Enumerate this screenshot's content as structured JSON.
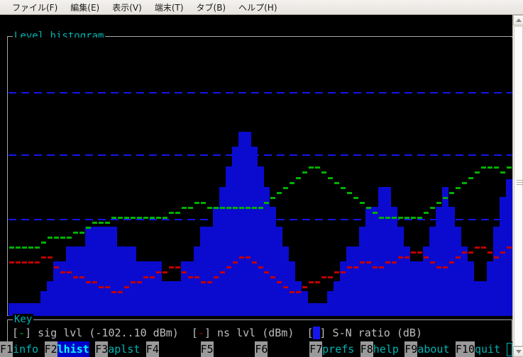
{
  "window": {
    "menu": [
      {
        "label": "ファイル(F)",
        "accel": "F"
      },
      {
        "label": "編集(E)",
        "accel": "E"
      },
      {
        "label": "表示(V)",
        "accel": "V"
      },
      {
        "label": "端末(T)",
        "accel": "T"
      },
      {
        "label": "タブ(B)",
        "accel": "B"
      },
      {
        "label": "ヘルプ(H)",
        "accel": "H"
      }
    ]
  },
  "histogram": {
    "title": "Level histogram"
  },
  "key": {
    "title": "Key",
    "sig_open": "[",
    "sig_mark": "-",
    "sig_close": "]",
    "sig_label": " sig lvl (-102..10 dBm)  ",
    "ns_open": "[",
    "ns_mark": "-",
    "ns_close": "]",
    "ns_label": " ns lvl (dBm)  ",
    "snr_open": "[",
    "snr_mark": " ",
    "snr_close": "]",
    "snr_label": " S-N ratio (dB)"
  },
  "fkeys": [
    {
      "num": "F1",
      "label": "info",
      "selected": false
    },
    {
      "num": "F2",
      "label": "lhist",
      "selected": true
    },
    {
      "num": "F3",
      "label": "aplst",
      "selected": false
    },
    {
      "num": "F4",
      "label": "",
      "selected": false
    },
    {
      "num": "F5",
      "label": "",
      "selected": false
    },
    {
      "num": "F6",
      "label": "",
      "selected": false
    },
    {
      "num": "F7",
      "label": "prefs",
      "selected": false
    },
    {
      "num": "F8",
      "label": "help",
      "selected": false
    },
    {
      "num": "F9",
      "label": "about",
      "selected": false
    },
    {
      "num": "F10",
      "label": "quit",
      "selected": false
    }
  ],
  "colors": {
    "sig": "#00b000",
    "ns": "#c00000",
    "snr": "#0b0bd0",
    "grid": "#1515ee",
    "frame": "#a8a8a8",
    "title": "#00b3b3",
    "background": "#000000"
  },
  "chart_data": {
    "type": "bar",
    "title": "Level histogram",
    "xlabel": "",
    "ylabel": "",
    "ylim": [
      -102,
      10
    ],
    "grid": true,
    "gridlines_y": [
      -12,
      -37,
      -63
    ],
    "legend": [
      "sig lvl (-102..10 dBm)",
      "ns lvl (dBm)",
      "S-N ratio (dB)"
    ],
    "legend_position": "below-plot",
    "n_columns": 79,
    "series": [
      {
        "name": "S-N ratio (dB)",
        "kind": "bar",
        "color": "#0b0bd0",
        "values": [
          5,
          5,
          5,
          5,
          5,
          10,
          14,
          22,
          22,
          28,
          28,
          28,
          36,
          36,
          36,
          36,
          36,
          28,
          28,
          28,
          22,
          22,
          22,
          22,
          14,
          14,
          14,
          22,
          22,
          28,
          36,
          36,
          44,
          52,
          60,
          68,
          74,
          74,
          68,
          60,
          52,
          44,
          36,
          28,
          22,
          14,
          10,
          5,
          5,
          5,
          10,
          14,
          22,
          28,
          28,
          36,
          44,
          44,
          52,
          52,
          44,
          36,
          28,
          22,
          22,
          28,
          36,
          44,
          52,
          44,
          36,
          28,
          22,
          14,
          14,
          22,
          36,
          48,
          55
        ]
      },
      {
        "name": "sig lvl (dBm)",
        "kind": "marker",
        "color": "#00b000",
        "values": [
          -74,
          -74,
          -74,
          -74,
          -74,
          -72,
          -70,
          -70,
          -70,
          -70,
          -68,
          -68,
          -66,
          -64,
          -64,
          -64,
          -62,
          -62,
          -62,
          -62,
          -62,
          -62,
          -62,
          -62,
          -62,
          -60,
          -60,
          -58,
          -58,
          -56,
          -56,
          -58,
          -58,
          -58,
          -58,
          -58,
          -58,
          -58,
          -58,
          -58,
          -56,
          -54,
          -52,
          -50,
          -48,
          -46,
          -44,
          -42,
          -42,
          -44,
          -46,
          -48,
          -50,
          -52,
          -54,
          -56,
          -58,
          -60,
          -62,
          -62,
          -62,
          -62,
          -62,
          -62,
          -62,
          -60,
          -58,
          -56,
          -54,
          -52,
          -50,
          -48,
          -46,
          -44,
          -42,
          -42,
          -42,
          -44,
          -42
        ]
      },
      {
        "name": "ns lvl (dBm)",
        "kind": "marker",
        "color": "#c00000",
        "values": [
          -80,
          -80,
          -80,
          -80,
          -80,
          -78,
          -78,
          -82,
          -84,
          -84,
          -86,
          -86,
          -88,
          -88,
          -90,
          -90,
          -92,
          -92,
          -90,
          -88,
          -88,
          -86,
          -86,
          -84,
          -84,
          -82,
          -82,
          -84,
          -86,
          -86,
          -88,
          -88,
          -86,
          -84,
          -82,
          -80,
          -78,
          -78,
          -80,
          -82,
          -84,
          -86,
          -88,
          -90,
          -92,
          -92,
          -90,
          -88,
          -88,
          -86,
          -86,
          -84,
          -84,
          -82,
          -82,
          -80,
          -80,
          -82,
          -82,
          -80,
          -80,
          -78,
          -78,
          -76,
          -76,
          -78,
          -80,
          -82,
          -82,
          -80,
          -78,
          -76,
          -76,
          -74,
          -74,
          -76,
          -78,
          -76,
          -74
        ]
      }
    ]
  }
}
